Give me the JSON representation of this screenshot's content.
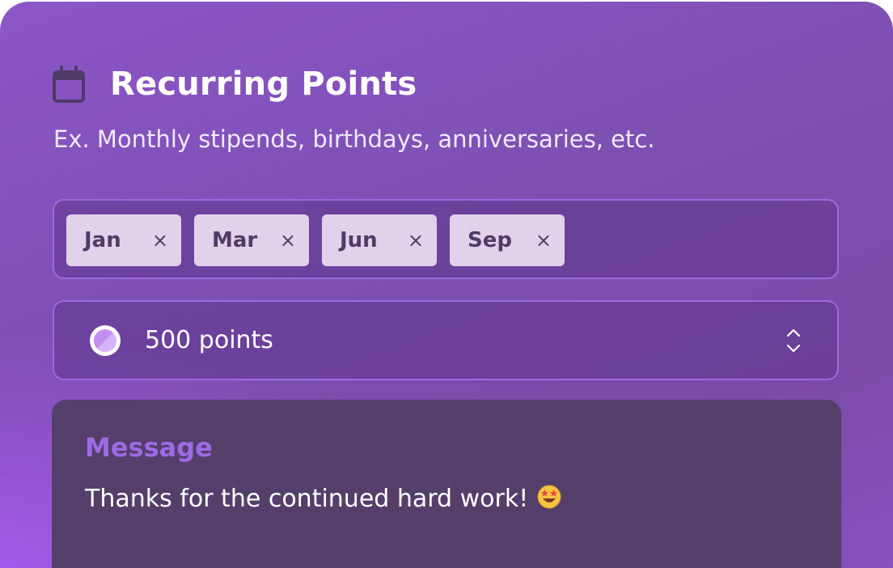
{
  "header": {
    "title": "Recurring Points",
    "subtitle": "Ex. Monthly stipends, birthdays, anniversaries, etc.",
    "icon": "calendar-icon"
  },
  "months": {
    "selected": [
      {
        "label": "Jan",
        "remove_icon": "×"
      },
      {
        "label": "Mar",
        "remove_icon": "×"
      },
      {
        "label": "Jun",
        "remove_icon": "×"
      },
      {
        "label": "Sep",
        "remove_icon": "×"
      }
    ]
  },
  "points": {
    "value_text": "500 points",
    "icon": "coin-icon",
    "stepper_icon": "chevron-up-down-icon"
  },
  "message": {
    "label": "Message",
    "text": "Thanks for the continued hard work!",
    "emoji_icon": "star-struck-emoji-icon"
  },
  "colors": {
    "accent": "#9e6ae6",
    "tag_background": "#e0d2ea",
    "message_background": "#543f6b"
  }
}
